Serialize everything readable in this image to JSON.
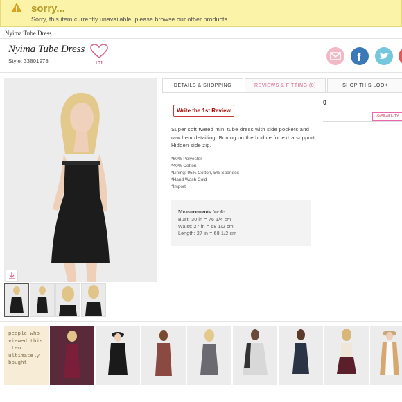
{
  "alert": {
    "title": "sorry...",
    "message": "Sorry, this item currently unavailable, please browse our other products."
  },
  "breadcrumb": "Nyima Tube Dress",
  "product": {
    "name": "Nyima Tube Dress",
    "style": "Style: 33801978",
    "likes": "101"
  },
  "social": [
    "email-icon",
    "facebook-icon",
    "twitter-icon",
    "pinterest-icon"
  ],
  "tabs": [
    "DETAILS & SHOPPING",
    "REVIEWS & FITTING (0)",
    "SHOP THIS LOOK"
  ],
  "review_button": "Write the 1st Review",
  "review_count": "0",
  "availability": "AVAILABILITY",
  "description": "Super soft tweed mini tube dress with side pockets and raw hem detailing. Boning on the bodice for extra support. Hidden side zip.",
  "specs": [
    "*60% Polyester",
    "*40% Cotton",
    "*Lining: 95% Cotton, 5% Spandex",
    "*Hand Wash Cold",
    "*Import"
  ],
  "measurements": {
    "heading": "Measurements for 6:",
    "lines": [
      "Bust: 30 in = 76 1/4 cm",
      "Waist: 27 in = 68 1/2 cm",
      "Length: 27 in = 68 1/2 cm"
    ]
  },
  "people_viewed": "people who viewed this item ultimately bought",
  "colors": {
    "alert_bg": "#fbf3a7",
    "alert_title": "#b49a2a",
    "accent_pink": "#d46a8a",
    "review_red": "#a00000"
  }
}
